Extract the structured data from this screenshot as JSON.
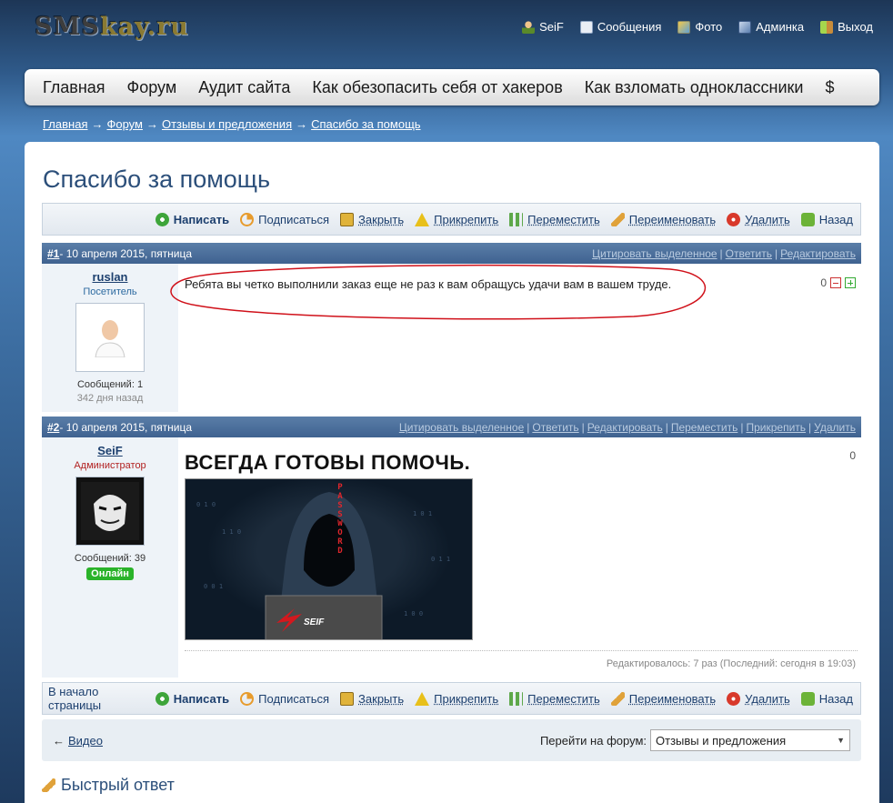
{
  "site": {
    "logo_main": "SMS",
    "logo_accent": "kay.ru"
  },
  "topnav": [
    {
      "icon": "user-icon",
      "label": "SeiF"
    },
    {
      "icon": "mail-icon",
      "label": "Сообщения"
    },
    {
      "icon": "photo-icon",
      "label": "Фото"
    },
    {
      "icon": "admin-icon",
      "label": "Админка"
    },
    {
      "icon": "exit-icon",
      "label": "Выход"
    }
  ],
  "menu": [
    "Главная",
    "Форум",
    "Аудит сайта",
    "Как обезопасить себя от хакеров",
    "Как взломать одноклассники",
    "$"
  ],
  "breadcrumb": [
    "Главная",
    "Форум",
    "Отзывы и предложения",
    "Спасибо за помощь"
  ],
  "breadcrumb_sep": "→",
  "page_title": "Спасибо за помощь",
  "toolbar": {
    "first_label": "В начало страницы",
    "write": "Написать",
    "subscribe": "Подписаться",
    "close": "Закрыть",
    "pin": "Прикрепить",
    "move": "Переместить",
    "rename": "Переименовать",
    "delete": "Удалить",
    "back": "Назад"
  },
  "posts": [
    {
      "num": "#1",
      "date": " - 10 апреля 2015, пятница",
      "actions": [
        "Цитировать выделенное",
        "Ответить",
        "Редактировать"
      ],
      "user": {
        "name": "ruslan",
        "role": "Посетитель",
        "role_color": "#2d6aa0",
        "messages": "Сообщений: 1",
        "sub": "342 дня назад"
      },
      "text": "Ребята вы четко выполнили заказ еще не раз к вам обращусь удачи вам в вашем труде.",
      "rating": "0"
    },
    {
      "num": "#2",
      "date": " - 10 апреля 2015, пятница",
      "actions": [
        "Цитировать выделенное",
        "Ответить",
        "Редактировать",
        "Переместить",
        "Прикрепить",
        "Удалить"
      ],
      "user": {
        "name": "SeiF",
        "role": "Администратор",
        "role_color": "#b22222",
        "messages": "Сообщений: 39",
        "status": "Онлайн"
      },
      "heading": "ВСЕГДА ГОТОВЫ ПОМОЧЬ.",
      "image_caption": "PASSWORD",
      "laptop_label": "SEIF",
      "edited": "Редактировалось: 7 раз (Последний: сегодня в 19:03)",
      "rating": "0"
    }
  ],
  "footer": {
    "prev_arrow": "←",
    "prev_link": "Видео",
    "goto_label": "Перейти на форум:",
    "goto_value": "Отзывы и предложения"
  },
  "quick_reply": "Быстрый ответ",
  "colors": {
    "accent": "#2c4f7a",
    "post_header": "#4a6f9b",
    "online": "#2ab32a"
  }
}
